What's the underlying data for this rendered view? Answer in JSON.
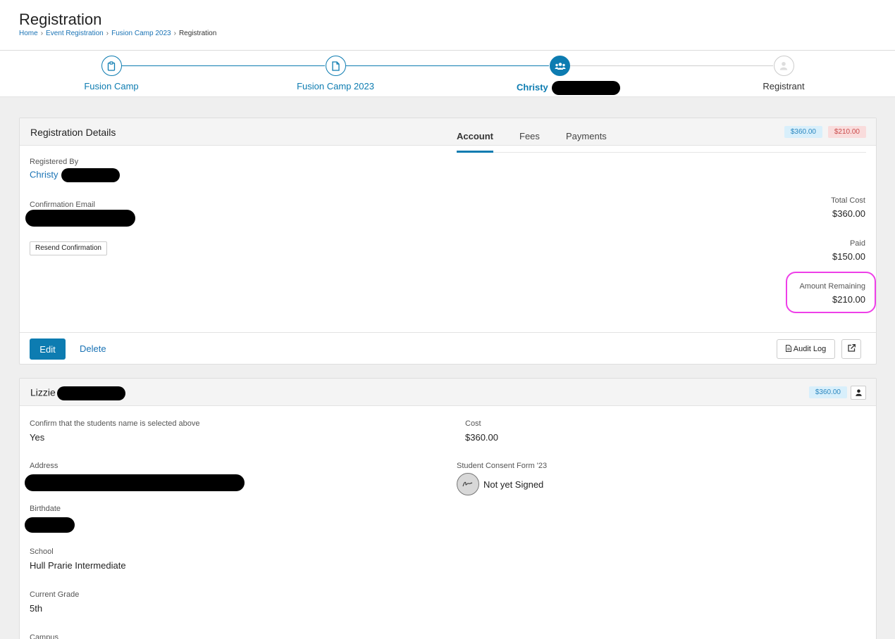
{
  "header": {
    "title": "Registration",
    "breadcrumb": [
      "Home",
      "Event Registration",
      "Fusion Camp 2023"
    ],
    "breadcrumb_current": "Registration",
    "separator": "›"
  },
  "stepper": {
    "steps": [
      {
        "label": "Fusion Camp",
        "icon": "clipboard-icon"
      },
      {
        "label": "Fusion Camp 2023",
        "icon": "document-icon"
      },
      {
        "label": "Christy",
        "icon": "group-icon"
      },
      {
        "label": "Registrant",
        "icon": "person-icon"
      }
    ]
  },
  "registration_details": {
    "title": "Registration Details",
    "badge_total": "$360.00",
    "badge_remaining": "$210.00",
    "registered_by_label": "Registered By",
    "registered_by_value": "Christy",
    "confirmation_email_label": "Confirmation Email",
    "resend_label": "Resend Confirmation",
    "tabs": [
      "Account",
      "Fees",
      "Payments"
    ],
    "total_cost_label": "Total Cost",
    "total_cost_value": "$360.00",
    "paid_label": "Paid",
    "paid_value": "$150.00",
    "remaining_label": "Amount Remaining",
    "remaining_value": "$210.00",
    "edit_label": "Edit",
    "delete_label": "Delete",
    "audit_log_label": "Audit Log"
  },
  "registrant": {
    "name": "Lizzie",
    "badge_cost": "$360.00",
    "confirm_label": "Confirm that the students name is selected above",
    "confirm_value": "Yes",
    "cost_label": "Cost",
    "cost_value": "$360.00",
    "address_label": "Address",
    "consent_label": "Student Consent Form '23",
    "consent_value": "Not yet Signed",
    "birthdate_label": "Birthdate",
    "school_label": "School",
    "school_value": "Hull Prarie Intermediate",
    "grade_label": "Current Grade",
    "grade_value": "5th",
    "campus_label": "Campus"
  },
  "colors": {
    "accent": "#0d7cb1",
    "highlight": "#ee3fe8",
    "badge_blue_bg": "#d8effb",
    "badge_red_bg": "#f9dcdc"
  }
}
